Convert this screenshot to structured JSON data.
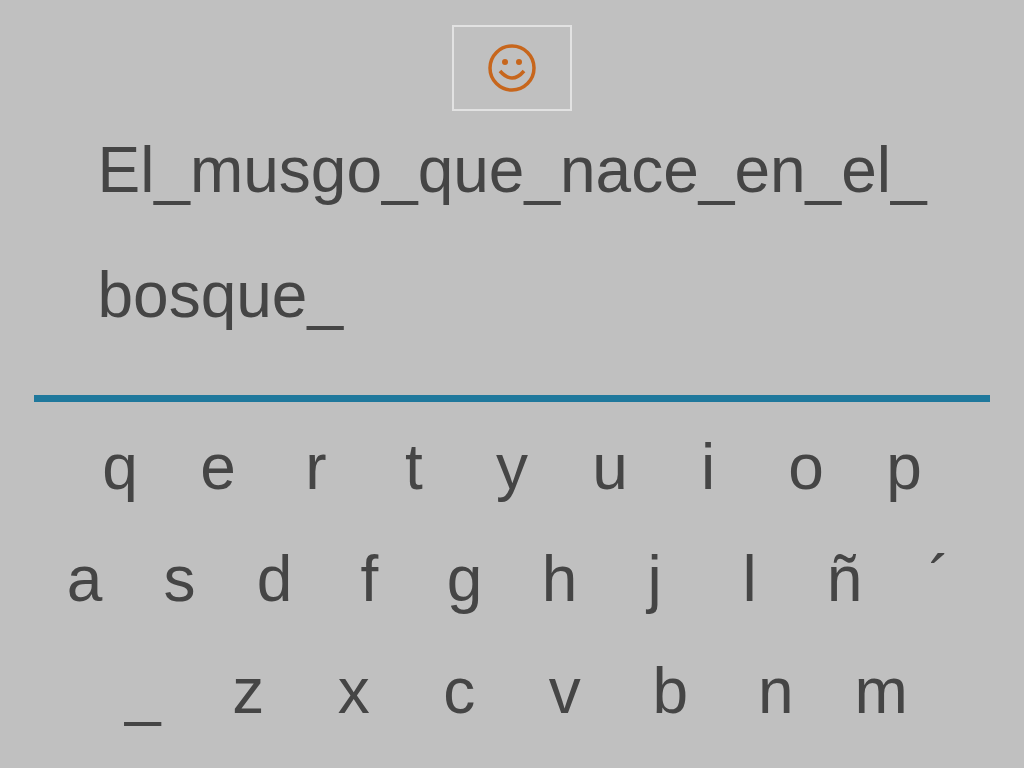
{
  "phrase_lines": [
    "El_musgo_que_nace_en_el_",
    "bosque_"
  ],
  "keyboard_rows": [
    [
      "q",
      "e",
      "r",
      "t",
      "y",
      "u",
      "i",
      "o",
      "p"
    ],
    [
      "a",
      "s",
      "d",
      "f",
      "g",
      "h",
      "j",
      "l",
      "ñ",
      "´"
    ],
    [
      "_",
      "z",
      "x",
      "c",
      "v",
      "b",
      "n",
      "m"
    ]
  ]
}
